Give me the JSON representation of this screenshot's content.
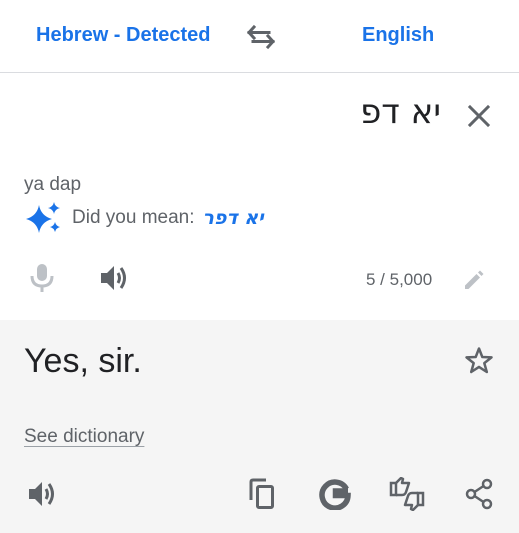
{
  "header": {
    "source_language": "Hebrew - Detected",
    "target_language": "English",
    "swap_icon": "swap-arrows-icon"
  },
  "input": {
    "text": "יא דפ",
    "transliteration": "ya dap",
    "did_you_mean_label": "Did you mean:",
    "did_you_mean_suggestion": "יא דפר",
    "char_count": "5 / 5,000"
  },
  "output": {
    "text": "Yes, sir.",
    "dictionary_link": "See dictionary"
  },
  "colors": {
    "accent": "#1a73e8",
    "icon": "#5f6368",
    "icon_disabled": "#bdc1c6",
    "text": "#202124",
    "output_bg": "#f5f5f5"
  }
}
